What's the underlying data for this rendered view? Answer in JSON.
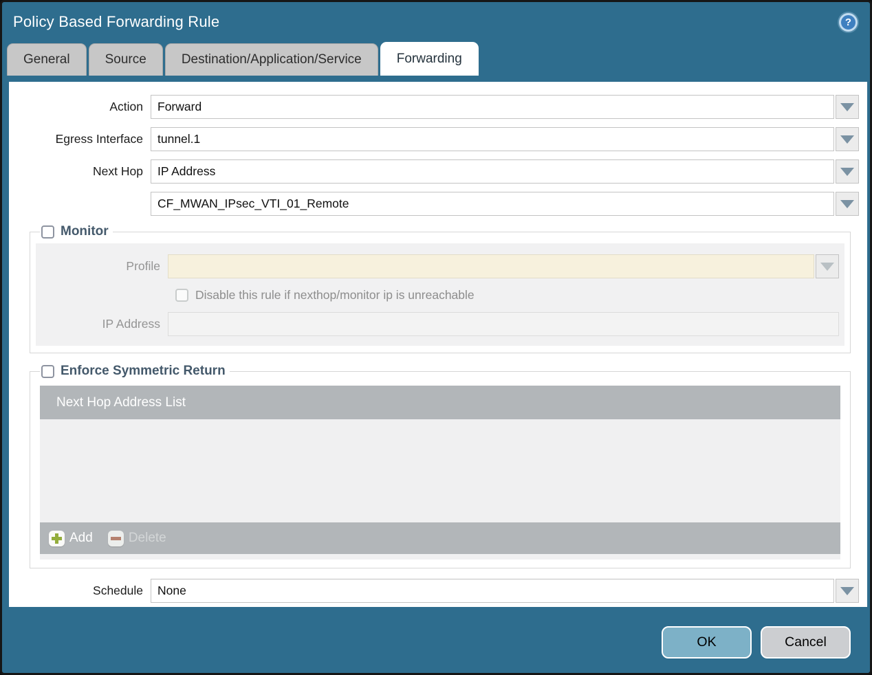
{
  "window": {
    "title": "Policy Based Forwarding Rule"
  },
  "icons": {
    "help": "?",
    "dropdown": "chevron-down",
    "add": "plus",
    "delete": "minus"
  },
  "tabs": [
    {
      "label": "General",
      "active": false
    },
    {
      "label": "Source",
      "active": false
    },
    {
      "label": "Destination/Application/Service",
      "active": false
    },
    {
      "label": "Forwarding",
      "active": true
    }
  ],
  "form": {
    "action": {
      "label": "Action",
      "value": "Forward"
    },
    "egress_interface": {
      "label": "Egress Interface",
      "value": "tunnel.1"
    },
    "next_hop": {
      "label": "Next Hop",
      "value": "IP Address"
    },
    "next_hop_address": {
      "value": "CF_MWAN_IPsec_VTI_01_Remote"
    },
    "schedule": {
      "label": "Schedule",
      "value": "None"
    }
  },
  "monitor": {
    "title": "Monitor",
    "checked": false,
    "profile": {
      "label": "Profile",
      "value": ""
    },
    "disable_rule": {
      "label": "Disable this rule if nexthop/monitor ip is unreachable",
      "checked": false
    },
    "ip_address": {
      "label": "IP Address",
      "value": ""
    }
  },
  "symmetric_return": {
    "title": "Enforce Symmetric Return",
    "checked": false,
    "table": {
      "header": "Next Hop Address List",
      "rows": []
    },
    "add_label": "Add",
    "delete_label": "Delete",
    "delete_enabled": false
  },
  "footer": {
    "ok_label": "OK",
    "cancel_label": "Cancel"
  },
  "colors": {
    "titlebar_teal": "#2e6d8e",
    "active_tab_bg": "#ffffff",
    "inactive_tab_bg": "#c7c7c7",
    "fieldset_title": "#44596b",
    "disabled_field_cream": "#f7f1dd",
    "table_header_gray": "#b2b6b9",
    "add_icon_green": "#93ad3c",
    "delete_icon_red": "#b5826f",
    "ok_button": "#7db1c7",
    "cancel_button": "#ccced1",
    "help_icon_blue": "#3f80c0"
  }
}
